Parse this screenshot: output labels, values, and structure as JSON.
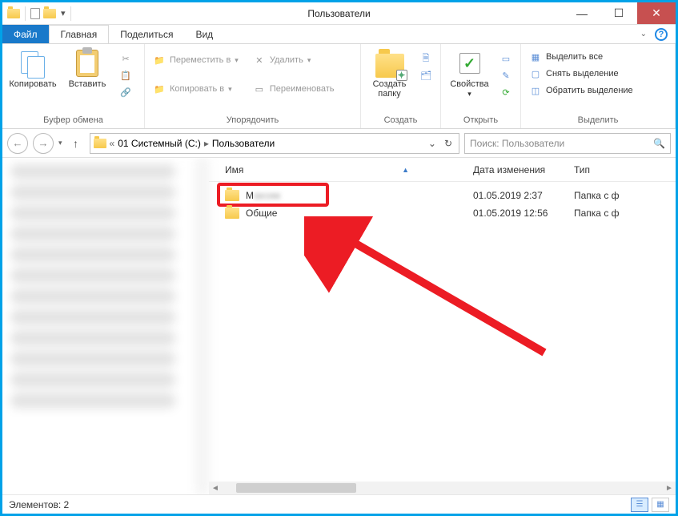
{
  "window": {
    "title": "Пользователи"
  },
  "menu": {
    "file": "Файл",
    "home": "Главная",
    "share": "Поделиться",
    "view": "Вид"
  },
  "ribbon": {
    "clipboard": {
      "copy": "Копировать",
      "paste": "Вставить",
      "label": "Буфер обмена"
    },
    "organize": {
      "moveTo": "Переместить в",
      "copyTo": "Копировать в",
      "delete": "Удалить",
      "rename": "Переименовать",
      "label": "Упорядочить"
    },
    "new": {
      "newFolder": "Создать папку",
      "label": "Создать"
    },
    "open": {
      "properties": "Свойства",
      "label": "Открыть"
    },
    "select": {
      "selectAll": "Выделить все",
      "selectNone": "Снять выделение",
      "invert": "Обратить выделение",
      "label": "Выделить"
    }
  },
  "address": {
    "seg1": "01 Системный (C:)",
    "seg2": "Пользователи",
    "chevrons": "«"
  },
  "search": {
    "placeholder": "Поиск: Пользователи"
  },
  "columns": {
    "name": "Имя",
    "date": "Дата изменения",
    "type": "Тип"
  },
  "files": [
    {
      "name": "M",
      "blurred": "аксим",
      "date": "01.05.2019 2:37",
      "type": "Папка с ф"
    },
    {
      "name": "Общие",
      "blurred": "",
      "date": "01.05.2019 12:56",
      "type": "Папка с ф"
    }
  ],
  "status": {
    "items": "Элементов: 2"
  }
}
